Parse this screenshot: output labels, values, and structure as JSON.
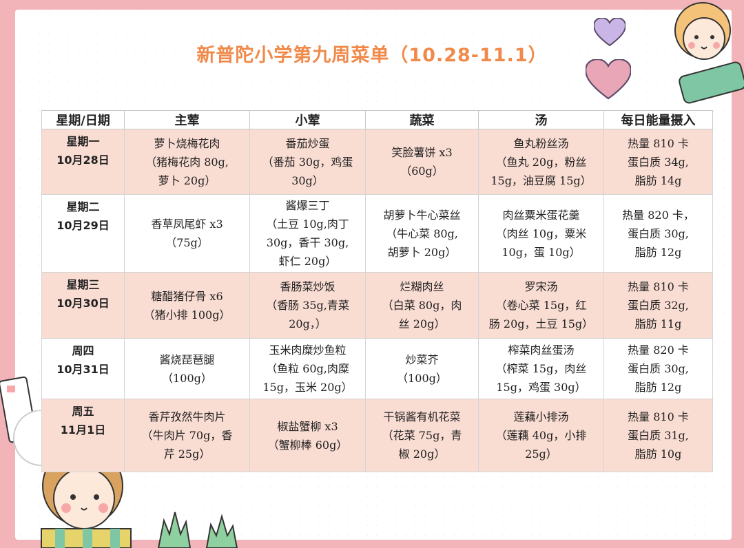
{
  "title": "新普陀小学第九周菜单（10.28-11.1）",
  "headers": [
    "星期/日期",
    "主荤",
    "小荤",
    "蔬菜",
    "汤",
    "每日能量摄入"
  ],
  "rows": [
    {
      "day": "星期一",
      "date": "10月28日",
      "main": [
        "萝卜烧梅花肉",
        "（猪梅花肉 80g,",
        "萝卜 20g）"
      ],
      "side": [
        "番茄炒蛋",
        "（番茄 30g，鸡蛋",
        "30g）"
      ],
      "veg": [
        "笑脸薯饼 x3",
        "（60g）"
      ],
      "soup": [
        "鱼丸粉丝汤",
        "（鱼丸 20g，粉丝",
        "15g，油豆腐 15g）"
      ],
      "energy": [
        "热量 810 卡",
        "蛋白质 34g,",
        "脂肪 14g"
      ]
    },
    {
      "day": "星期二",
      "date": "10月29日",
      "main": [
        "香草凤尾虾 x3",
        "（75g）"
      ],
      "side": [
        "酱爆三丁",
        "（土豆 10g,肉丁",
        "30g，香干 30g,",
        "虾仁 20g）"
      ],
      "veg": [
        "胡萝卜牛心菜丝",
        "（牛心菜 80g,",
        "胡萝卜 20g）"
      ],
      "soup": [
        "肉丝粟米蛋花羹",
        "（肉丝 10g，粟米",
        "10g，蛋 10g）"
      ],
      "energy": [
        "热量 820 卡，",
        "蛋白质 30g,",
        "脂肪 12g"
      ]
    },
    {
      "day": "星期三",
      "date": "10月30日",
      "main": [
        "糖醋猪仔骨 x6",
        "（猪小排 100g）"
      ],
      "side": [
        "香肠菜炒饭",
        "（香肠 35g,青菜",
        "20g，）"
      ],
      "veg": [
        "烂糊肉丝",
        "（白菜 80g，肉",
        "丝 20g）"
      ],
      "soup": [
        "罗宋汤",
        "（卷心菜 15g，红",
        "肠 20g，土豆 15g）"
      ],
      "energy": [
        "热量 810 卡",
        "蛋白质 32g,",
        "脂肪 11g"
      ]
    },
    {
      "day": "周四",
      "date": "10月31日",
      "main": [
        "酱烧琵琶腿",
        "（100g）"
      ],
      "side": [
        "玉米肉糜炒鱼粒",
        "（鱼粒 60g,肉糜",
        "15g，玉米 20g）"
      ],
      "veg": [
        "炒菜芥",
        "（100g）"
      ],
      "soup": [
        "榨菜肉丝蛋汤",
        "（榨菜 15g，肉丝",
        "15g，鸡蛋 30g）"
      ],
      "energy": [
        "热量 820 卡",
        "蛋白质 30g,",
        "脂肪 12g"
      ]
    },
    {
      "day": "周五",
      "date": "11月1日",
      "main": [
        "香芹孜然牛肉片",
        "（牛肉片 70g，香",
        "芹 25g）"
      ],
      "side": [
        "椒盐蟹柳 x3",
        "（蟹柳棒 60g）"
      ],
      "veg": [
        "干锅酱有机花菜",
        "（花菜 75g，青",
        "椒 20g）"
      ],
      "soup": [
        "莲藕小排汤",
        "（莲藕 40g，小排",
        "25g）"
      ],
      "energy": [
        "热量 810 卡",
        "蛋白质 31g,",
        "脂肪 10g"
      ]
    }
  ],
  "colors": {
    "title": "#f08a4b",
    "row_pink": "#f9dcd2",
    "background": "#f2b4b9",
    "heart": "#c9b6e6"
  },
  "icons": [
    "heart-icon",
    "girl-illustration",
    "grass-icon",
    "pencil-icon"
  ]
}
